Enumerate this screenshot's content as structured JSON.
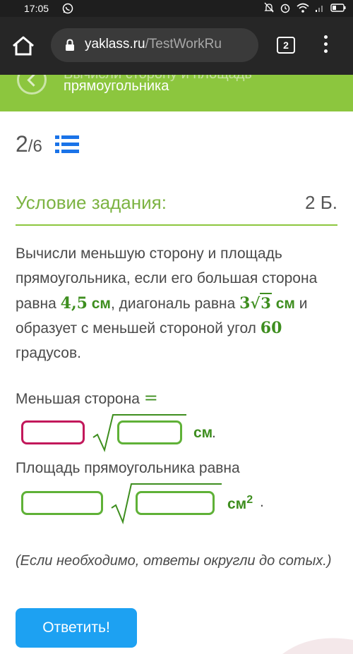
{
  "status_bar": {
    "time": "17:05"
  },
  "browser": {
    "url_domain": "yaklass.ru",
    "url_path": "/TestWorkRu",
    "tab_count": "2"
  },
  "header": {
    "title_line1": "Вычисли сторону и площадь",
    "title": "прямоугольника"
  },
  "counter": {
    "current": "2",
    "separator": "/",
    "total": "6"
  },
  "condition": {
    "title": "Условие задания:",
    "points": "2 Б."
  },
  "problem": {
    "p1": "Вычисли меньшую сторону и площадь прямоугольника, если его большая сторона равна ",
    "side_value": "4,5",
    "side_unit": " см",
    "p2": ", диагональ равна ",
    "diag_coef": "3",
    "diag_radicand": "3",
    "diag_unit": " см",
    "p3": " и образует с меньшей стороной угол ",
    "angle": "60",
    "p4": " градусов."
  },
  "answer": {
    "label1": "Меньшая сторона ",
    "eq": "=",
    "unit1": "см",
    "trail1": ".",
    "label2": "Площадь прямоугольника равна",
    "unit2": "см",
    "unit2_exp": "2",
    "trail2": ".",
    "inputs": [
      {
        "value": "",
        "state": "active"
      },
      {
        "value": ""
      },
      {
        "value": ""
      },
      {
        "value": ""
      }
    ]
  },
  "note": "(Если необходимо, ответы округли до сотых.)",
  "submit_label": "Ответить!",
  "colors": {
    "accent_green": "#8cc63e",
    "math_green": "#3e8e1f",
    "active_border": "#c2185b",
    "button_blue": "#1da1f2"
  },
  "icons": [
    "whatsapp-icon",
    "alarm-off-icon",
    "alarm-icon",
    "wifi-icon",
    "signal-icon",
    "battery-icon",
    "home-icon",
    "lock-icon",
    "tabs-icon",
    "more-icon",
    "back-icon",
    "list-icon"
  ]
}
